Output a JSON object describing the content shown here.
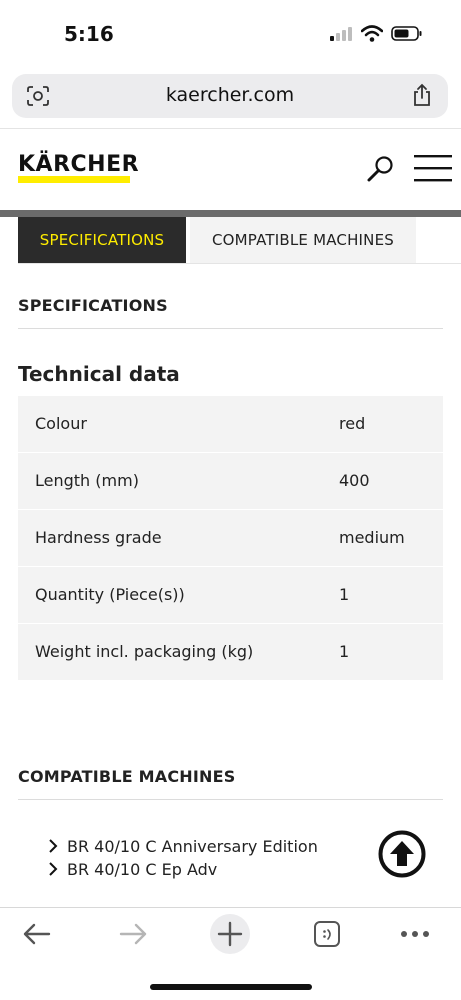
{
  "status_bar": {
    "time": "5:16"
  },
  "browser": {
    "url": "kaercher.com"
  },
  "site": {
    "logo_text": "KÄRCHER",
    "brand_yellow": "#ffed00",
    "dark": "#2b2b2b"
  },
  "tabs": [
    {
      "label": "SPECIFICATIONS",
      "active": true
    },
    {
      "label": "COMPATIBLE MACHINES",
      "active": false
    }
  ],
  "specifications": {
    "heading": "SPECIFICATIONS",
    "technical_data_title": "Technical data",
    "rows": [
      {
        "label": "Colour",
        "value": "red"
      },
      {
        "label": "Length (mm)",
        "value": "400"
      },
      {
        "label": "Hardness grade",
        "value": "medium"
      },
      {
        "label": "Quantity (Piece(s))",
        "value": "1"
      },
      {
        "label": "Weight incl. packaging (kg)",
        "value": "1"
      }
    ]
  },
  "compatible_machines": {
    "heading": "COMPATIBLE MACHINES",
    "items": [
      "BR 40/10 C Anniversary Edition",
      "BR 40/10 C Ep Adv"
    ]
  },
  "toolbar": {
    "icons": [
      "back-arrow-icon",
      "forward-arrow-icon",
      "new-tab-plus-icon",
      "tabs-icon",
      "more-icon"
    ]
  }
}
